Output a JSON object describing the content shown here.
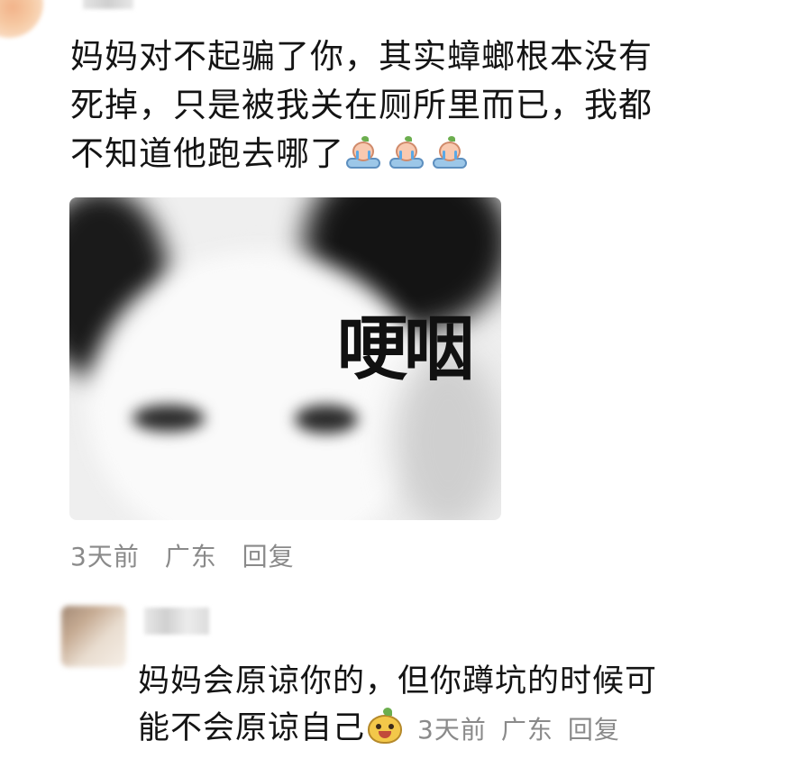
{
  "comment": {
    "line1": "妈妈对不起骗了你，其实蟑螂根本没有",
    "line2": "死掉，只是被我关在厕所里而已，我都",
    "line3": "不知道他跑去哪了",
    "emoji_name": "crying-emoji",
    "meme_text": "哽咽",
    "time": "3天前",
    "location": "广东",
    "reply_label": "回复"
  },
  "reply": {
    "line1": "妈妈会原谅你的，但你蹲坑的时候可",
    "line2": "能不会原谅自己",
    "emoji_name": "laughing-emoji",
    "time": "3天前",
    "location": "广东",
    "reply_label": "回复"
  }
}
